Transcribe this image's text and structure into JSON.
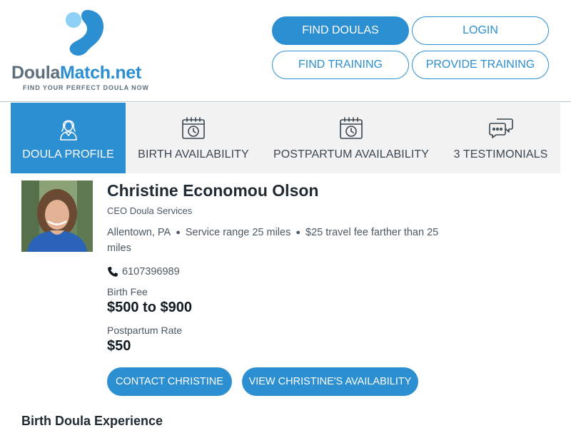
{
  "brand": {
    "name_part1": "Doula",
    "name_part2": "Match.net",
    "tagline": "FIND YOUR PERFECT DOULA NOW",
    "primary_color": "#2b8fd1",
    "secondary_color": "#5e6f7c"
  },
  "nav": {
    "find_doulas": "FIND DOULAS",
    "login": "LOGIN",
    "find_training": "FIND TRAINING",
    "provide_training": "PROVIDE TRAINING"
  },
  "tabs": [
    {
      "label": "DOULA PROFILE",
      "icon": "doula-person-icon",
      "active": true
    },
    {
      "label": "BIRTH AVAILABILITY",
      "icon": "calendar-clock-icon",
      "active": false
    },
    {
      "label": "POSTPARTUM AVAILABILITY",
      "icon": "calendar-clock-icon",
      "active": false
    },
    {
      "label": "3 TESTIMONIALS",
      "icon": "chat-bubbles-icon",
      "active": false
    }
  ],
  "profile": {
    "name": "Christine Economou Olson",
    "company": "CEO Doula Services",
    "location": "Allentown, PA",
    "service_range": "Service range 25 miles",
    "travel_fee": "$25 travel fee farther than 25 miles",
    "phone": "6107396989",
    "birth_fee_label": "Birth Fee",
    "birth_fee": "$500 to $900",
    "postpartum_label": "Postpartum Rate",
    "postpartum_rate": "$50"
  },
  "actions": {
    "contact": "CONTACT CHRISTINE",
    "availability": "VIEW CHRISTINE'S AVAILABILITY"
  },
  "sections": {
    "birth_experience": "Birth Doula Experience"
  }
}
